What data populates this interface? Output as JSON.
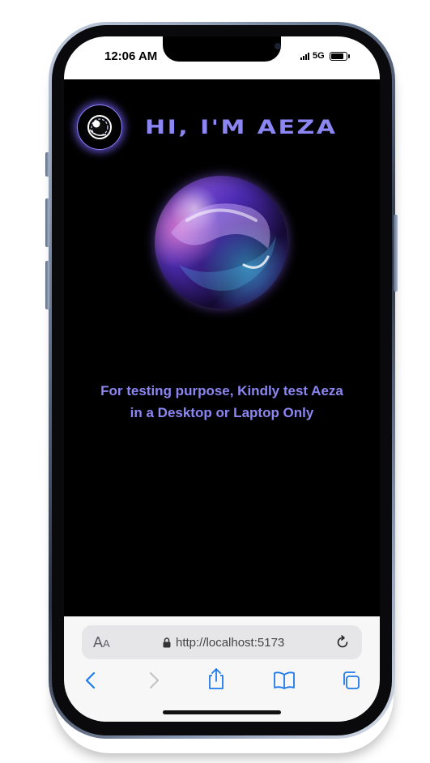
{
  "status_bar": {
    "time": "12:06 AM",
    "network": "5G"
  },
  "header": {
    "title": "HI, I'M AEZA"
  },
  "main": {
    "message_line1": "For testing purpose, Kindly test Aeza",
    "message_line2": "in a Desktop or Laptop Only"
  },
  "browser": {
    "text_size_label_large": "A",
    "text_size_label_small": "A",
    "url": "http://localhost:5173"
  },
  "icons": {
    "logo": "eye-logo-icon",
    "orb": "glass-orb",
    "lock": "lock-icon",
    "reload": "reload-icon",
    "back": "chevron-left-icon",
    "forward": "chevron-right-icon",
    "share": "share-icon",
    "bookmarks": "book-icon",
    "tabs": "tabs-icon"
  },
  "battery_level": 0.85,
  "colors": {
    "accent": "#8c86f3",
    "safari_blue": "#1f7aea",
    "background": "#000000"
  }
}
